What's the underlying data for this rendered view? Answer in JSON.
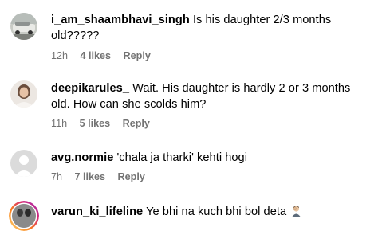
{
  "comments": [
    {
      "username": "i_am_shaambhavi_singh",
      "text": "Is his daughter 2/3 months old?????",
      "time": "12h",
      "likes": "4 likes",
      "reply": "Reply",
      "avatar_icon": "car-photo-avatar"
    },
    {
      "username": "deepikarules_",
      "text": "Wait. His daughter is hardly 2 or 3 months old. How can she scolds him?",
      "time": "11h",
      "likes": "5 likes",
      "reply": "Reply",
      "avatar_icon": "person-photo-avatar"
    },
    {
      "username": "avg.normie",
      "text": "'chala ja tharki' kehti hogi",
      "time": "7h",
      "likes": "7 likes",
      "reply": "Reply",
      "avatar_icon": "default-user-avatar"
    },
    {
      "username": "varun_ki_lifeline",
      "text": "Ye bhi na kuch bhi bol deta",
      "emoji_icon": "man-facepalming-emoji",
      "avatar_icon": "story-ring-avatar"
    }
  ],
  "colors": {
    "meta": "#737373",
    "story_ring": "#d6249f"
  }
}
